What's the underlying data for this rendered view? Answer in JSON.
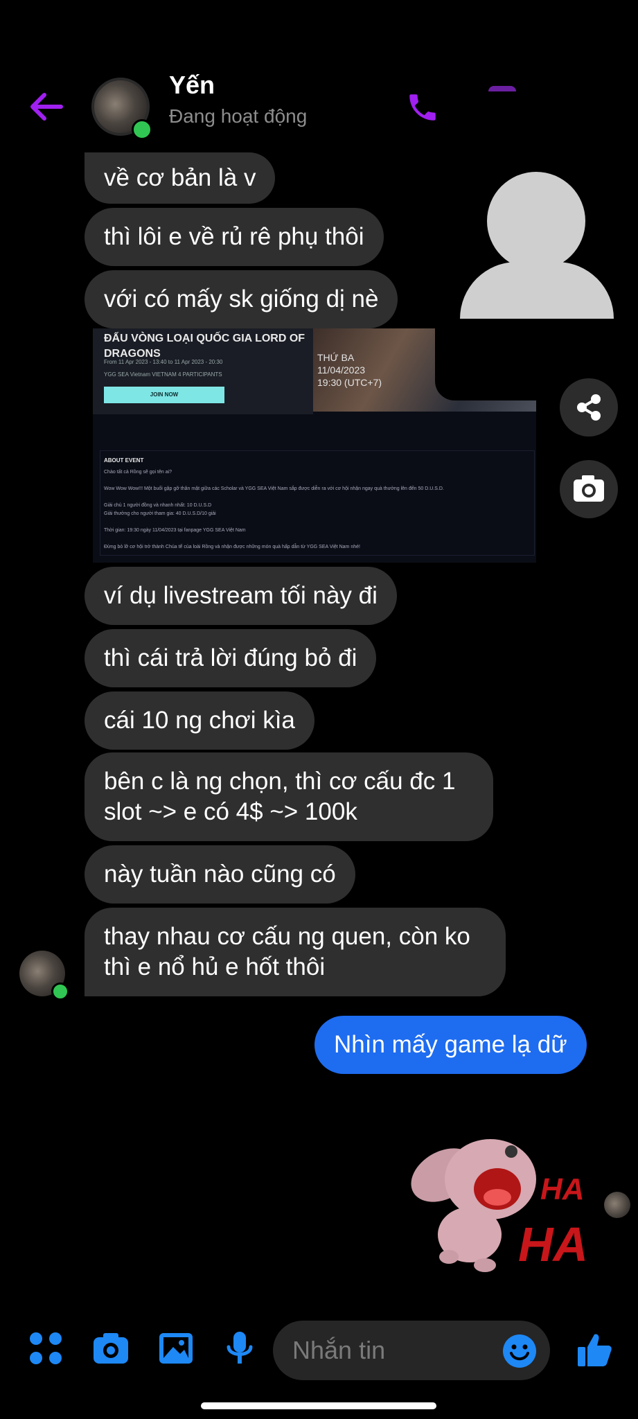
{
  "header": {
    "contact_name": "Yến",
    "status": "Đang hoạt động"
  },
  "messages_received_top": [
    "về cơ bản là v",
    "thì lôi e về rủ rê phụ thôi",
    "với có mấy sk giống dị nè"
  ],
  "shared_card": {
    "title": "ĐẤU VÒNG LOẠI QUỐC GIA LORD OF DRAGONS",
    "meta": "From 11 Apr 2023 - 13:40  to  11 Apr 2023 - 20:30",
    "meta2": "YGG SEA Vietnam   VIETNAM   4 PARTICIPANTS",
    "join_label": "JOIN NOW",
    "banner_day": "THỨ BA",
    "banner_date": "11/04/2023",
    "banner_time": "19:30 (UTC+7)",
    "about_label": "ABOUT EVENT",
    "about_lines": [
      "Chào tất cả Rồng sẽ gọi tên ai?",
      "Wow Wow Wow!!! Một buổi gặp gỡ thân mật giữa các Scholar và YGG SEA Việt Nam sắp được diễn ra với cơ hội nhận ngay quà thưởng lên đến 50 D.U.S.D.",
      "Giải chủ 1 người đồng và nhanh nhất: 10 D.U.S.D",
      "Giải thưởng cho người tham gia: 40 D.U.S.D/10 giải",
      "Thời gian: 19:30 ngày 11/04/2023 tại fanpage YGG SEA Việt Nam",
      "Đừng bỏ lỡ cơ hội trở thành Chúa tể của loài Rồng và nhận được những món quà hấp dẫn từ YGG SEA Việt Nam nhé!"
    ]
  },
  "messages_received_bottom": [
    "ví dụ livestream tối này đi",
    "thì cái trả lời đúng bỏ đi",
    "cái 10 ng chơi kìa",
    "bên c là ng chọn, thì cơ cấu đc 1 slot ~> e có 4$ ~> 100k",
    "này tuần nào cũng có",
    "thay nhau cơ cấu ng quen, còn ko thì e nổ hủ e hốt thôi"
  ],
  "messages_sent": [
    "Nhìn mấy game lạ dữ"
  ],
  "sticker": {
    "text_1": "HA",
    "text_2": "HA"
  },
  "composer": {
    "placeholder": "Nhắn tin"
  },
  "colors": {
    "accent_purple": "#a020f0",
    "accent_blue": "#1e6cf0",
    "bubble_gray": "#2f2f2f",
    "online_green": "#31c653"
  },
  "icons": [
    "back-arrow-icon",
    "phone-icon",
    "share-icon",
    "camera-icon",
    "apps-icon",
    "gallery-icon",
    "microphone-icon",
    "emoji-icon",
    "thumbs-up-icon"
  ]
}
